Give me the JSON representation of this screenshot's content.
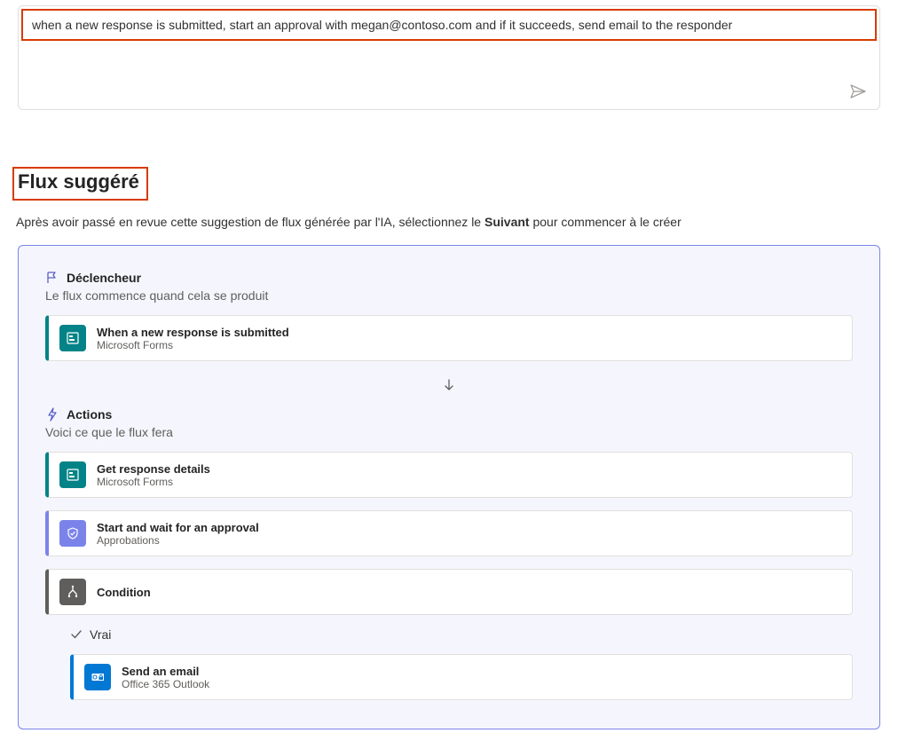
{
  "prompt": "when a new response is submitted, start an approval with megan@contoso.com and if it succeeds, send email to the responder",
  "heading": "Flux suggéré",
  "subtitle_pre": "Après avoir passé en revue cette suggestion de flux générée par l'IA, sélectionnez le ",
  "subtitle_bold": "Suivant",
  "subtitle_post": " pour commencer à le créer",
  "trigger": {
    "label": "Déclencheur",
    "desc": "Le flux commence quand cela se produit",
    "step": {
      "title": "When a new response is submitted",
      "sub": "Microsoft Forms"
    }
  },
  "actions": {
    "label": "Actions",
    "desc": "Voici ce que le flux fera",
    "steps": [
      {
        "title": "Get response details",
        "sub": "Microsoft Forms"
      },
      {
        "title": "Start and wait for an approval",
        "sub": "Approbations"
      },
      {
        "title": "Condition",
        "sub": ""
      }
    ],
    "branch_true_label": "Vrai",
    "branch_true_step": {
      "title": "Send an email",
      "sub": "Office 365 Outlook"
    }
  }
}
